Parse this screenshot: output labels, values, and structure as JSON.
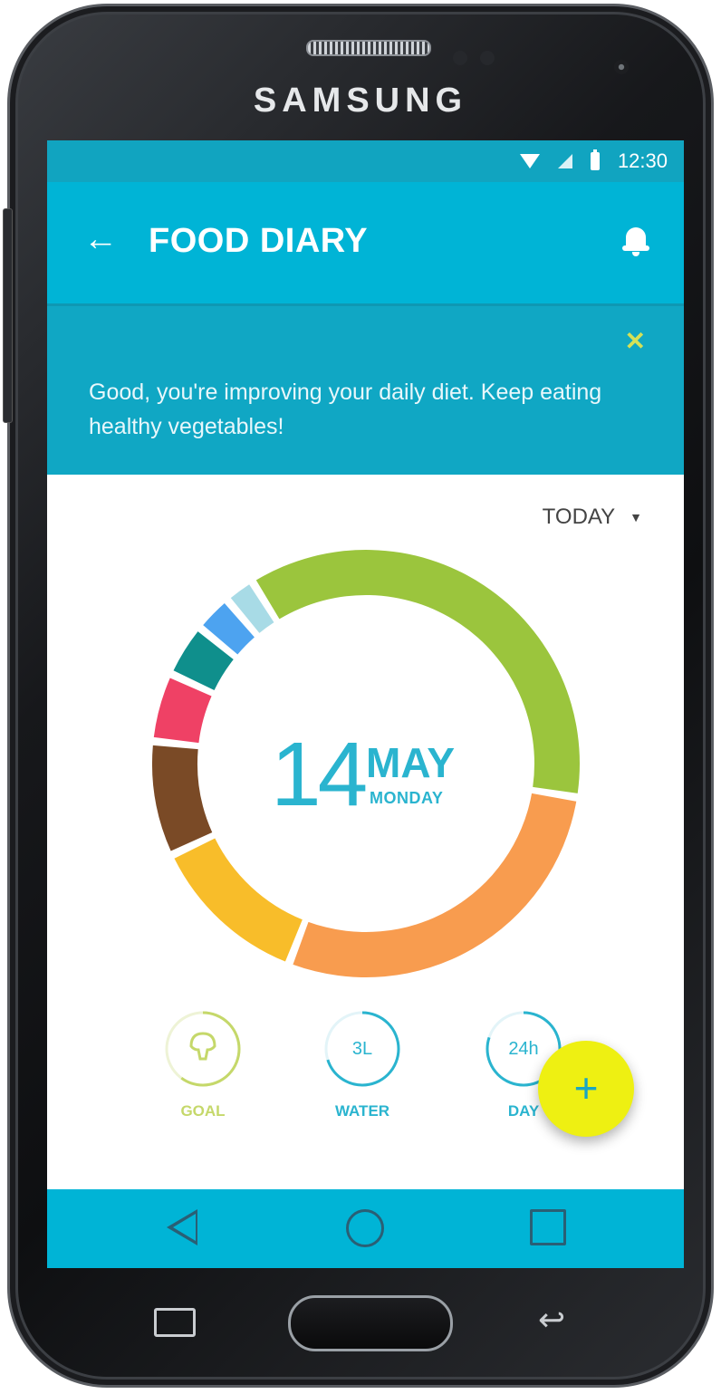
{
  "device": {
    "brand": "SAMSUNG"
  },
  "status_bar": {
    "time": "12:30"
  },
  "app_bar": {
    "title": "FOOD DIARY"
  },
  "banner": {
    "message": "Good, you're improving your daily diet. Keep eating healthy vegetables!",
    "close_label": "✕"
  },
  "period_selector": {
    "value": "TODAY"
  },
  "date": {
    "day": "14",
    "month": "MAY",
    "weekday": "MONDAY"
  },
  "chart_data": {
    "type": "donut",
    "segments": [
      {
        "color": "#9bc53d",
        "fraction": 0.315
      },
      {
        "color": "#f89c4f",
        "fraction": 0.245
      },
      {
        "color": "#f8bd2a",
        "fraction": 0.105
      },
      {
        "color": "#7a4a26",
        "fraction": 0.075
      },
      {
        "color": "#ef4165",
        "fraction": 0.045
      },
      {
        "color": "#0f8f8c",
        "fraction": 0.035
      },
      {
        "color": "#4da3f0",
        "fraction": 0.025
      },
      {
        "color": "#a8dbe6",
        "fraction": 0.02
      }
    ]
  },
  "stats": [
    {
      "label": "GOAL",
      "value": "",
      "icon": "broccoli-icon",
      "color": "#c5d86a",
      "progress": 0.6
    },
    {
      "label": "WATER",
      "value": "3L",
      "icon": "",
      "color": "#2ab4cf",
      "progress": 0.7
    },
    {
      "label": "DAY",
      "value": "24h",
      "icon": "",
      "color": "#2ab4cf",
      "progress": 0.8
    }
  ],
  "fab": {
    "label": "+"
  }
}
